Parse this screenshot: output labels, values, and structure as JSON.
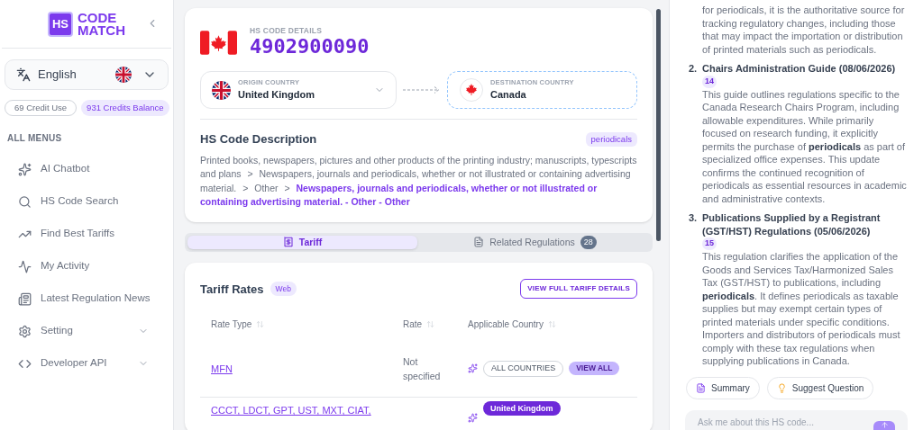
{
  "sidebar": {
    "logo": {
      "badge": "HS",
      "line_1": "CODE",
      "line_2": "MATCH"
    },
    "language": "English",
    "credits": {
      "used": "69 Credit Use",
      "balance": "931 Credits Balance"
    },
    "section_title": "ALL MENUS",
    "items": [
      {
        "label": "AI Chatbot",
        "kind": "link"
      },
      {
        "label": "HS Code Search",
        "kind": "link"
      },
      {
        "label": "Find Best Tariffs",
        "kind": "link"
      },
      {
        "label": "My Activity",
        "kind": "link"
      },
      {
        "label": "Latest Regulation News",
        "kind": "link"
      },
      {
        "label": "Setting",
        "kind": "group",
        "expanded": false
      },
      {
        "label": "Developer API",
        "kind": "group",
        "expanded": false
      }
    ]
  },
  "hs_code": {
    "label": "HS CODE DETAILS",
    "code": "4902900090"
  },
  "route": {
    "origin": {
      "label": "ORIGIN COUNTRY",
      "country": "United Kingdom"
    },
    "destination": {
      "label": "DESTINATION COUNTRY",
      "country": "Canada"
    }
  },
  "description": {
    "title": "HS Code Description",
    "tag": "periodicals",
    "separator": ">",
    "path": [
      "Printed books, newspapers, pictures and other products of the printing industry; manuscripts, typescripts and plans",
      "Newspapers, journals and periodicals, whether or not illustrated or containing advertising material.",
      "Other"
    ],
    "leaf": "Newspapers, journals and periodicals, whether or not illustrated or containing advertising material. - Other - Other"
  },
  "tabs": [
    {
      "label": "Tariff",
      "selected": true
    },
    {
      "label": "Related Regulations",
      "selected": false,
      "count": "28"
    }
  ],
  "tariff": {
    "title": "Tariff Rates",
    "source_badge": "Web",
    "action": "VIEW FULL TARIFF DETAILS",
    "columns": [
      "Rate Type",
      "Rate",
      "Applicable Country"
    ],
    "rows": [
      {
        "rate_type": "MFN",
        "rate": "Not specified",
        "countries": [
          {
            "label": "ALL COUNTRIES",
            "kind": "outline"
          },
          {
            "label": "VIEW ALL",
            "kind": "action"
          }
        ]
      },
      {
        "rate_type": "CCCT, LDCT, GPT, UST, MXT, CIAT,",
        "countries": [
          {
            "label": "United Kingdom",
            "kind": "filled"
          }
        ]
      }
    ]
  },
  "assistant": {
    "items": [
      {
        "body": "for periodicals, it is the authoritative source for tracking regulatory changes, including those that may impact the importation or distribution of printed materials such as periodicals."
      },
      {
        "number": "2.",
        "title": "Chairs Administration Guide (08/06/2026)",
        "ref": "14",
        "body": "This guide outlines regulations specific to the Canada Research Chairs Program, including allowable expenditures. While primarily focused on research funding, it explicitly permits the purchase of **periodicals** as part of specialized office expenses. This update confirms the continued recognition of periodicals as essential resources in academic and administrative contexts."
      },
      {
        "number": "3.",
        "title": "Publications Supplied by a Registrant (GST/HST) Regulations (05/06/2026)",
        "ref": "15",
        "body": "This regulation clarifies the application of the Goods and Services Tax/Harmonized Sales Tax (GST/HST) to publications, including **periodicals**. It defines periodicals as taxable supplies but may exempt certain types of printed materials under specific conditions. Importers and distributors of periodicals must comply with these tax regulations when supplying publications in Canada."
      }
    ],
    "actions": [
      {
        "label": "Summary",
        "kind": "summary"
      },
      {
        "label": "Suggest Question",
        "kind": "suggest"
      }
    ],
    "input": {
      "placeholder": "Ask me about this HS code..."
    }
  }
}
